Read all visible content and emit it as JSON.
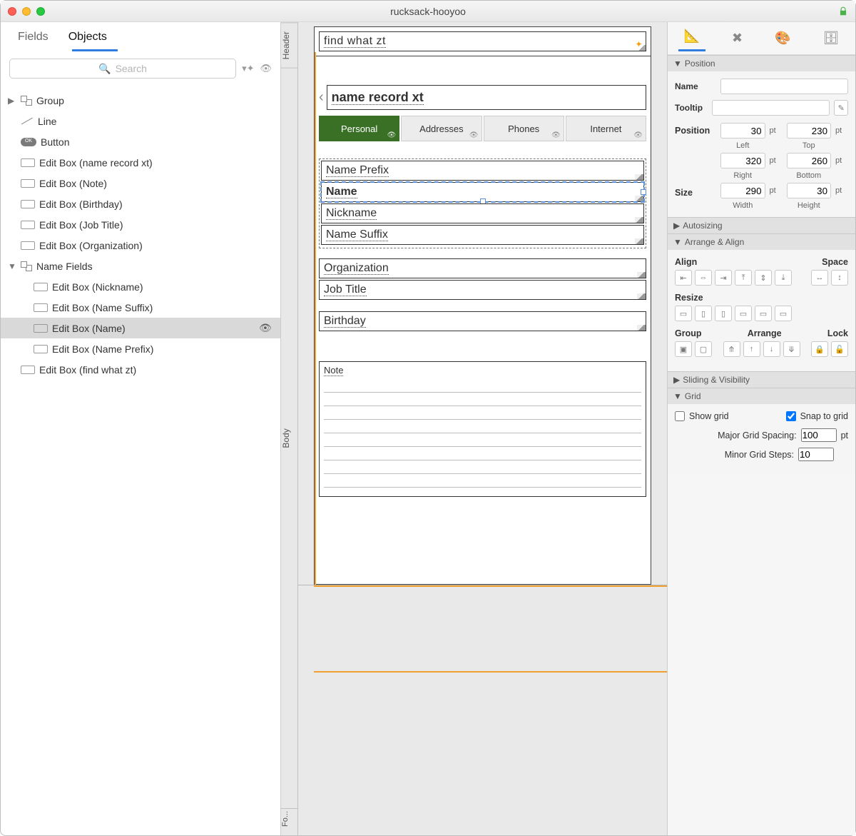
{
  "window": {
    "title": "rucksack-hooyoo"
  },
  "sidebar": {
    "tabs": [
      "Fields",
      "Objects"
    ],
    "active_tab": 1,
    "search_placeholder": "Search",
    "tree": [
      {
        "label": "Group",
        "icon": "group",
        "depth": 0,
        "disc": "right"
      },
      {
        "label": "Line",
        "icon": "line",
        "depth": 0
      },
      {
        "label": "Button",
        "icon": "button",
        "depth": 0
      },
      {
        "label": "Edit Box (name record xt)",
        "icon": "box",
        "depth": 0
      },
      {
        "label": "Edit Box (Note)",
        "icon": "box",
        "depth": 0
      },
      {
        "label": "Edit Box (Birthday)",
        "icon": "box",
        "depth": 0
      },
      {
        "label": "Edit Box (Job Title)",
        "icon": "box",
        "depth": 0
      },
      {
        "label": "Edit Box (Organization)",
        "icon": "box",
        "depth": 0
      },
      {
        "label": "Name Fields",
        "icon": "group",
        "depth": 0,
        "disc": "down"
      },
      {
        "label": "Edit Box (Nickname)",
        "icon": "box",
        "depth": 1
      },
      {
        "label": "Edit Box (Name Suffix)",
        "icon": "box",
        "depth": 1
      },
      {
        "label": "Edit Box (Name)",
        "icon": "box",
        "depth": 1,
        "selected": true,
        "eye": true
      },
      {
        "label": "Edit Box (Name Prefix)",
        "icon": "box",
        "depth": 1
      },
      {
        "label": "Edit Box (find what zt)",
        "icon": "box",
        "depth": 0
      }
    ]
  },
  "canvas": {
    "rails": {
      "header": "Header",
      "body": "Body",
      "footer": "Fo..."
    },
    "header_field": "find what zt",
    "record_title": "name record xt",
    "tabs": [
      "Personal",
      "Addresses",
      "Phones",
      "Internet"
    ],
    "active_tab": 0,
    "name_fields": [
      "Name Prefix",
      "Name",
      "Nickname",
      "Name Suffix"
    ],
    "selected_name_field": 1,
    "other_fields": [
      "Organization",
      "Job Title"
    ],
    "birthday": "Birthday",
    "note": "Note"
  },
  "inspector": {
    "sections": {
      "position": "Position",
      "autosizing": "Autosizing",
      "arrange": "Arrange & Align",
      "sliding": "Sliding & Visibility",
      "grid": "Grid"
    },
    "name_label": "Name",
    "tooltip_label": "Tooltip",
    "position_label": "Position",
    "size_label": "Size",
    "pos": {
      "left": "30",
      "top": "230",
      "right": "320",
      "bottom": "260",
      "width": "290",
      "height": "30"
    },
    "pos_labels": {
      "left": "Left",
      "top": "Top",
      "right": "Right",
      "bottom": "Bottom",
      "width": "Width",
      "height": "Height"
    },
    "unit": "pt",
    "align_label": "Align",
    "space_label": "Space",
    "resize_label": "Resize",
    "group_label": "Group",
    "arrange_label": "Arrange",
    "lock_label": "Lock",
    "grid": {
      "show": "Show grid",
      "snap": "Snap to grid",
      "show_checked": false,
      "snap_checked": true,
      "major_label": "Major Grid Spacing:",
      "major": "100",
      "minor_label": "Minor Grid Steps:",
      "minor": "10"
    }
  }
}
